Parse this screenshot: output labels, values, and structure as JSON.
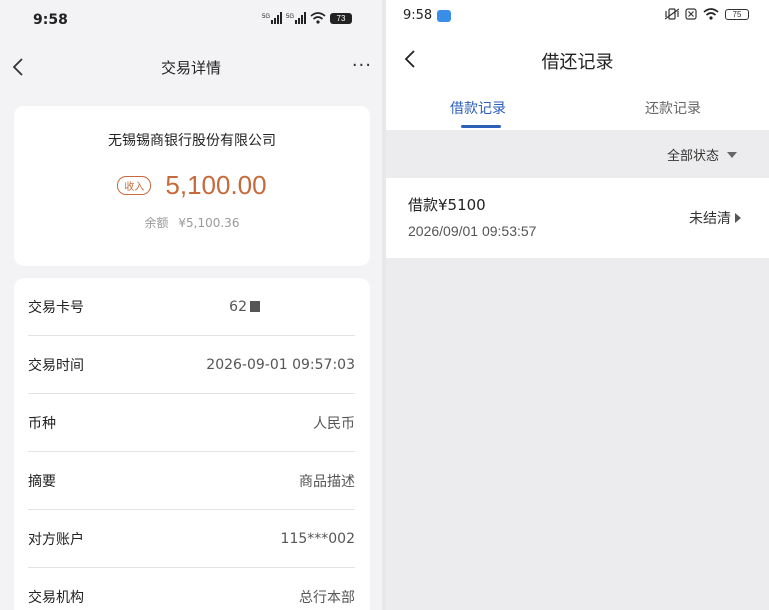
{
  "left": {
    "status": {
      "time": "9:58",
      "battery": "73",
      "signal1": "5G",
      "signal2": "5G"
    },
    "nav": {
      "title": "交易详情",
      "more": "···"
    },
    "summary": {
      "bank": "无锡锡商银行股份有限公司",
      "badge": "收入",
      "amount": "5,100.00",
      "balance_label": "余额",
      "balance_value": "¥5,100.36"
    },
    "details": [
      {
        "label": "交易卡号",
        "value": "62"
      },
      {
        "label": "交易时间",
        "value": "2026-09-01 09:57:03"
      },
      {
        "label": "币种",
        "value": "人民币"
      },
      {
        "label": "摘要",
        "value": "商品描述"
      },
      {
        "label": "对方账户",
        "value": "115***002"
      },
      {
        "label": "交易机构",
        "value": "总行本部"
      }
    ],
    "colors": {
      "amount": "#c76a3b"
    }
  },
  "right": {
    "status": {
      "time": "9:58",
      "battery": "75"
    },
    "nav": {
      "title": "借还记录"
    },
    "tabs": [
      {
        "label": "借款记录",
        "active": true
      },
      {
        "label": "还款记录",
        "active": false
      }
    ],
    "filter": {
      "label": "全部状态"
    },
    "records": [
      {
        "title": "借款¥5100",
        "date": "2026/09/01 09:53:57",
        "status": "未结清"
      }
    ],
    "colors": {
      "accent": "#2b5fb8"
    }
  }
}
